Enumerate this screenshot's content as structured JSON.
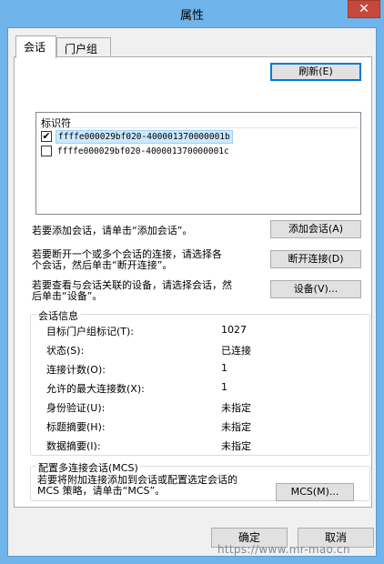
{
  "window": {
    "title": "属性",
    "close_glyph": "✕"
  },
  "tabs": [
    {
      "label": "会话",
      "active": true
    },
    {
      "label": "门户组",
      "active": false
    }
  ],
  "refresh_button": "刷新(E)",
  "session_list": {
    "header": "标识符",
    "rows": [
      {
        "checked": true,
        "selected": true,
        "id": "ffffe000029bf020-400001370000001b"
      },
      {
        "checked": false,
        "selected": false,
        "id": "ffffe000029bf020-400001370000001c"
      }
    ]
  },
  "actions": {
    "add": {
      "text": "若要添加会话，请单击“添加会话”。",
      "button": "添加会话(A)"
    },
    "disconnect": {
      "text_line1": "若要断开一个或多个会话的连接，请选择各",
      "text_line2": "个会话，然后单击“断开连接”。",
      "button": "断开连接(D)"
    },
    "devices": {
      "text_line1": "若要查看与会话关联的设备，请选择会话，然",
      "text_line2": "后单击“设备”。",
      "button": "设备(V)..."
    }
  },
  "session_info": {
    "title": "会话信息",
    "rows": [
      {
        "key": "目标门户组标记(T):",
        "value": "1027"
      },
      {
        "key": "状态(S):",
        "value": "已连接"
      },
      {
        "key": "连接计数(O):",
        "value": "1"
      },
      {
        "key": "允许的最大连接数(X):",
        "value": "1"
      },
      {
        "key": "身份验证(U):",
        "value": "未指定"
      },
      {
        "key": "标题摘要(H):",
        "value": "未指定"
      },
      {
        "key": "数据摘要(I):",
        "value": "未指定"
      }
    ]
  },
  "mcs": {
    "title": "配置多连接会话(MCS)",
    "text_line1": "若要将附加连接添加到会话或配置选定会话的",
    "text_line2": "MCS 策略，请单击“MCS”。",
    "button": "MCS(M)..."
  },
  "footer": {
    "ok": "确定",
    "cancel": "取消"
  },
  "watermark": "https://www.mr-mao.cn"
}
